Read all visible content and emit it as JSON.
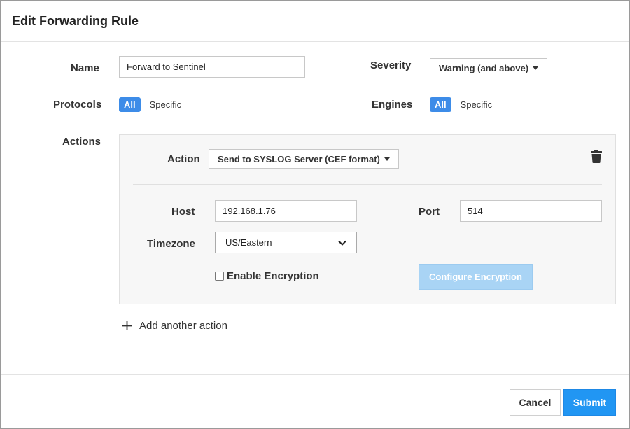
{
  "dialog": {
    "title": "Edit Forwarding Rule"
  },
  "form": {
    "name_label": "Name",
    "name_value": "Forward to Sentinel",
    "severity_label": "Severity",
    "severity_value": "Warning (and above)",
    "protocols_label": "Protocols",
    "protocols_options": {
      "all": "All",
      "specific": "Specific",
      "selected": "All"
    },
    "engines_label": "Engines",
    "engines_options": {
      "all": "All",
      "specific": "Specific",
      "selected": "All"
    },
    "actions_label": "Actions"
  },
  "action": {
    "action_label": "Action",
    "action_value": "Send to SYSLOG Server (CEF format)",
    "host_label": "Host",
    "host_value": "192.168.1.76",
    "port_label": "Port",
    "port_value": "514",
    "timezone_label": "Timezone",
    "timezone_value": "US/Eastern",
    "encryption_label": "Enable Encryption",
    "encryption_checked": false,
    "configure_encryption_label": "Configure Encryption",
    "delete_icon": "trash-icon"
  },
  "add_action_label": "Add another action",
  "footer": {
    "cancel_label": "Cancel",
    "submit_label": "Submit"
  },
  "colors": {
    "accent": "#2196f3",
    "toggle_on": "#3d8ce8",
    "disabled_button": "#a9d4f5"
  }
}
